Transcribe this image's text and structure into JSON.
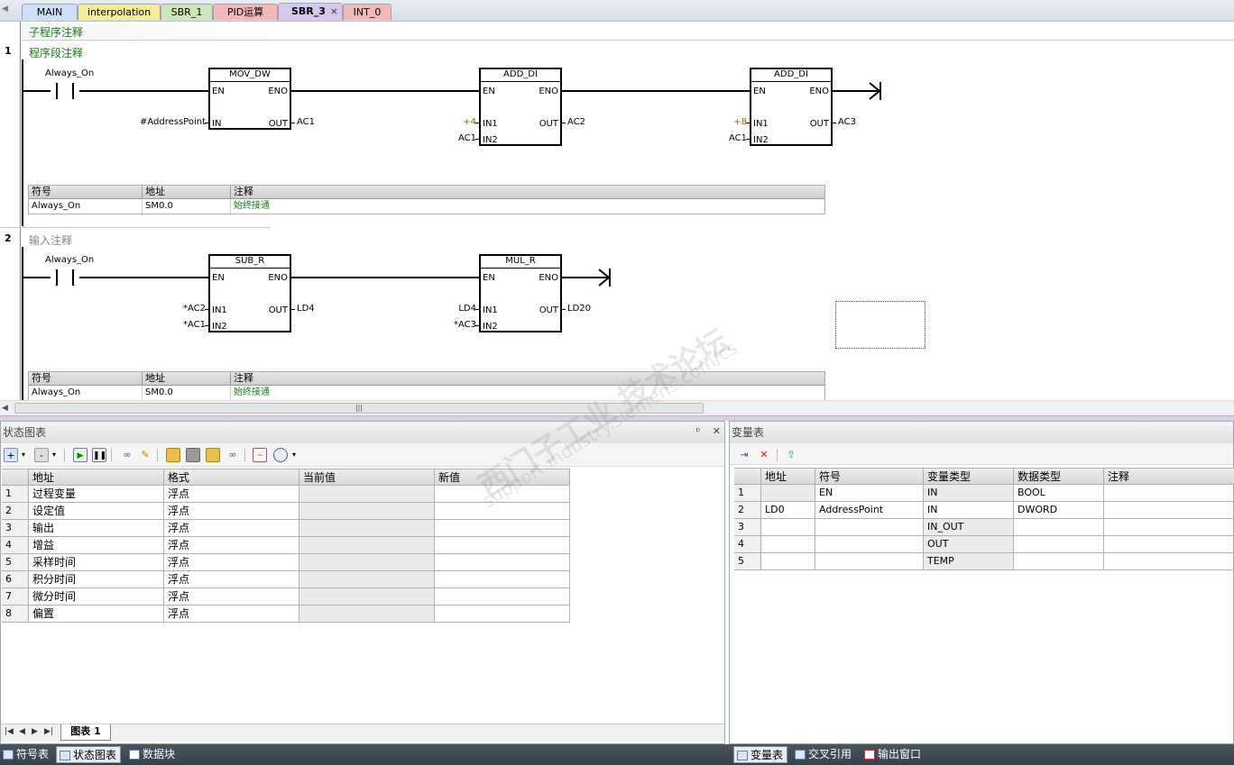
{
  "tabs": [
    {
      "label": "MAIN",
      "color": "#cfe0f6"
    },
    {
      "label": "interpolation",
      "color": "#f6ec9a"
    },
    {
      "label": "SBR_1",
      "color": "#cfe6b8"
    },
    {
      "label": "PID运算",
      "color": "#f5b8b8"
    },
    {
      "label": "SBR_3",
      "color": "#d8c8ec",
      "active": true
    },
    {
      "label": "INT_0",
      "color": "#f5b8b8"
    }
  ],
  "tab_close": "×",
  "editor": {
    "subroutine_comment": "子程序注释",
    "networks": [
      {
        "number": "1",
        "comment": "程序段注释",
        "contact_label": "Always_On",
        "boxes": [
          {
            "title": "MOV_DW",
            "in_pins": [
              "EN",
              "IN"
            ],
            "out_pins": [
              "ENO",
              "OUT"
            ],
            "inputs": [
              "",
              "#AddressPoint"
            ],
            "outputs": [
              "",
              "AC1"
            ]
          },
          {
            "title": "ADD_DI",
            "in_pins": [
              "EN",
              "IN1",
              "IN2"
            ],
            "out_pins": [
              "ENO",
              "OUT"
            ],
            "inputs": [
              "",
              "+4",
              "AC1"
            ],
            "outputs": [
              "",
              "AC2"
            ]
          },
          {
            "title": "ADD_DI",
            "in_pins": [
              "EN",
              "IN1",
              "IN2"
            ],
            "out_pins": [
              "ENO",
              "OUT"
            ],
            "inputs": [
              "",
              "+8",
              "AC1"
            ],
            "outputs": [
              "",
              "AC3"
            ]
          }
        ],
        "symbol_table": {
          "headers": [
            "符号",
            "地址",
            "注释"
          ],
          "row": [
            "Always_On",
            "SM0.0",
            "始终接通"
          ]
        }
      },
      {
        "number": "2",
        "comment": "输入注释",
        "contact_label": "Always_On",
        "boxes": [
          {
            "title": "SUB_R",
            "in_pins": [
              "EN",
              "IN1",
              "IN2"
            ],
            "out_pins": [
              "ENO",
              "OUT"
            ],
            "inputs": [
              "",
              "*AC2",
              "*AC1"
            ],
            "outputs": [
              "",
              "LD4"
            ]
          },
          {
            "title": "MUL_R",
            "in_pins": [
              "EN",
              "IN1",
              "IN2"
            ],
            "out_pins": [
              "ENO",
              "OUT"
            ],
            "inputs": [
              "",
              "LD4",
              "*AC3"
            ],
            "outputs": [
              "",
              "LD20"
            ]
          }
        ],
        "symbol_table": {
          "headers": [
            "符号",
            "地址",
            "注释"
          ],
          "row": [
            "Always_On",
            "SM0.0",
            "始终接通"
          ]
        }
      }
    ]
  },
  "scroll_grip": "|||",
  "status_chart": {
    "title": "状态图表",
    "pin": "ᵖ",
    "close": "✕",
    "headers": [
      "地址",
      "格式",
      "当前值",
      "新值"
    ],
    "rows": [
      {
        "n": "1",
        "addr": "过程变量",
        "fmt": "浮点",
        "cur": "",
        "new": ""
      },
      {
        "n": "2",
        "addr": "设定值",
        "fmt": "浮点",
        "cur": "",
        "new": ""
      },
      {
        "n": "3",
        "addr": "输出",
        "fmt": "浮点",
        "cur": "",
        "new": ""
      },
      {
        "n": "4",
        "addr": "增益",
        "fmt": "浮点",
        "cur": "",
        "new": ""
      },
      {
        "n": "5",
        "addr": "采样时间",
        "fmt": "浮点",
        "cur": "",
        "new": ""
      },
      {
        "n": "6",
        "addr": "积分时间",
        "fmt": "浮点",
        "cur": "",
        "new": ""
      },
      {
        "n": "7",
        "addr": "微分时间",
        "fmt": "浮点",
        "cur": "",
        "new": ""
      },
      {
        "n": "8",
        "addr": "偏置",
        "fmt": "浮点",
        "cur": "",
        "new": ""
      }
    ],
    "sheet_tab": "图表  1"
  },
  "var_table": {
    "title": "变量表",
    "headers": [
      "地址",
      "符号",
      "变量类型",
      "数据类型",
      "注释"
    ],
    "rows": [
      {
        "n": "1",
        "addr": "",
        "sym": "EN",
        "vtype": "IN",
        "dtype": "BOOL",
        "comment": ""
      },
      {
        "n": "2",
        "addr": "LD0",
        "sym": "AddressPoint",
        "vtype": "IN",
        "dtype": "DWORD",
        "comment": ""
      },
      {
        "n": "3",
        "addr": "",
        "sym": "",
        "vtype": "IN_OUT",
        "dtype": "",
        "comment": ""
      },
      {
        "n": "4",
        "addr": "",
        "sym": "",
        "vtype": "OUT",
        "dtype": "",
        "comment": ""
      },
      {
        "n": "5",
        "addr": "",
        "sym": "",
        "vtype": "TEMP",
        "dtype": "",
        "comment": ""
      }
    ]
  },
  "bottom_tabs_left": [
    "符号表",
    "状态图表",
    "数据块"
  ],
  "bottom_tabs_right": [
    "变量表",
    "交叉引用",
    "输出窗口"
  ],
  "watermark": {
    "line1": "西门子工业  技术论坛",
    "line2": "support.industry.siemens.com/cs"
  }
}
